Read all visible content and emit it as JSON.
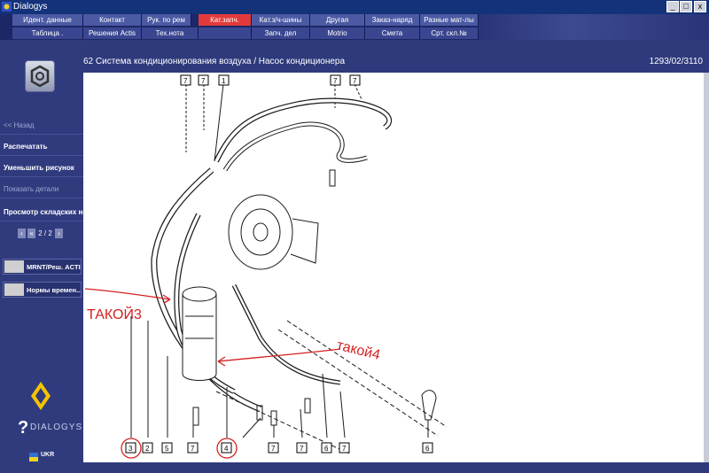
{
  "window": {
    "title": "Dialogys"
  },
  "menu": {
    "row1": [
      "Идент. данные",
      "Контакт",
      "Рук. по рем",
      "Кат.запч.",
      "Кат.з/ч-шины",
      "Другая",
      "Заказ-наряд",
      "Разные мат-лы"
    ],
    "row2": [
      "Таблица .",
      "Решения Actis",
      "Тех.нота",
      "",
      "Запч. дел",
      "Motrio",
      "Смета",
      "Срт. скл.№"
    ],
    "active": "Кат.запч."
  },
  "sidebar": {
    "back": "<< Назад",
    "print": "Распечатать",
    "zoom_out": "Уменьшить рисунок",
    "show_details": "Показать детали",
    "stock_view": "Просмотр складских но...",
    "pager": "2 / 2",
    "shortcut1": "MRNT/Реш. ACTIS",
    "shortcut2": "Нормы времен...",
    "brand": "DIALOGYS",
    "flag_text": "UKR"
  },
  "page": {
    "title": "62 Система кондиционирования воздуха / Насос кондиционера",
    "code": "1293/02/3110"
  },
  "diagram": {
    "callouts_top": [
      "7",
      "7",
      "1",
      "7",
      "7"
    ],
    "callouts_bottom": [
      "3",
      "2",
      "5",
      "7",
      "4",
      "7",
      "7",
      "6",
      "7",
      "6"
    ],
    "annotations": [
      "ТАКОЙ3",
      "такой4"
    ]
  },
  "colors": {
    "annotation": "#d42020",
    "active_menu": "#e23a3a"
  }
}
